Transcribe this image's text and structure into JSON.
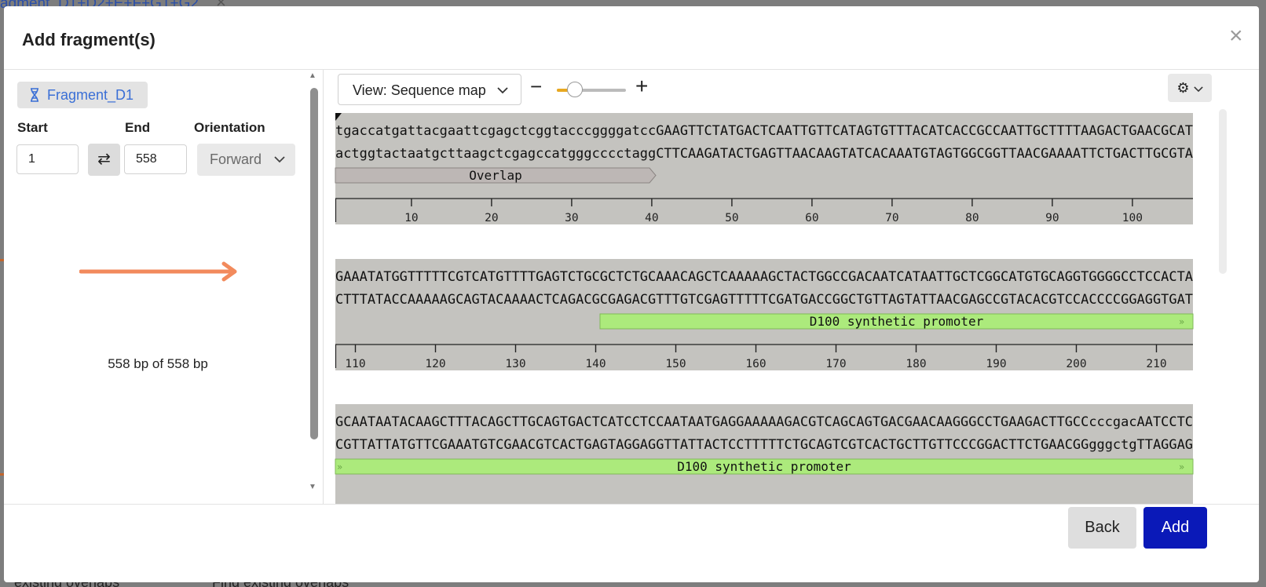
{
  "background": {
    "title_fragment": "agment_D1+D2+E+F+G1+G2",
    "close_glyph": "×",
    "bottom_left": "existing overlaps",
    "bottom_right": "Find existing overlaps"
  },
  "modal": {
    "title": "Add fragment(s)",
    "close_glyph": "×"
  },
  "fragment": {
    "chip_label": "Fragment_D1",
    "start_label": "Start",
    "end_label": "End",
    "orientation_label": "Orientation",
    "start_value": "1",
    "end_value": "558",
    "orientation_value": "Forward",
    "summary": "558 bp of 558 bp",
    "arrow_color": "#f28a5c"
  },
  "viewer": {
    "view_select": "View: Sequence map",
    "zoom_out": "−",
    "zoom_in": "+",
    "zoom_level": 0.15,
    "rows": [
      {
        "top": "tgaccatgattacgaattcgagctcggtacccggggatccGAAGTTCTATGACTCAATTGTTCATAGTGTTTACATCACCGCCAATTGCTTTTAAGACTGAACGCAT",
        "bottom": "actggtactaatgcttaagctcgagccatgggcccctaggCTTCAAGATACTGAGTTAACAAGTATCACAAATGTAGTGGCGGTTAACGAAAATTCTGACTTGCGTA",
        "ticks": [
          "10",
          "20",
          "30",
          "40",
          "50",
          "60",
          "70",
          "80",
          "90",
          "100"
        ],
        "feature": "Overlap"
      },
      {
        "top": "GAAATATGGTTTTTCGTCATGTTTTGAGTCTGCGCTCTGCAAACAGCTCAAAAAGCTACTGGCCGACAATCATAATTGCTCGGCATGTGCAGGTGGGGCCTCCACTA",
        "bottom": "CTTTATACCAAAAAGCAGTACAAAACTCAGACGCGAGACGTTTGTCGAGTTTTTCGATGACCGGCTGTTAGTATTAACGAGCCGTACACGTCCACCCCGGAGGTGAT",
        "ticks": [
          "110",
          "120",
          "130",
          "140",
          "150",
          "160",
          "170",
          "180",
          "190",
          "200",
          "210"
        ],
        "feature": "D100 synthetic promoter"
      },
      {
        "top": "GCAATAATACAAGCTTTACAGCTTGCAGTGACTCATCCTCCAATAATGAGGAAAAAGACGTCAGCAGTGACGAACAAGGGCCTGAAGACTTGCCcccgacAATCCTC",
        "bottom": "CGTTATTATGTTCGAAATGTCGAACGTCACTGAGTAGGAGGTTATTACTCCTTTTTCTGCAGTCGTCACTGCTTGTTCCCGGACTTCTGAACGGgggctgTTAGGAG",
        "feature": "D100 synthetic promoter"
      }
    ],
    "overlap_color": "#bdb7b5",
    "promoter_color": "#acea7c",
    "row_bg": "#c4c3bf"
  },
  "footer": {
    "back_label": "Back",
    "add_label": "Add"
  }
}
